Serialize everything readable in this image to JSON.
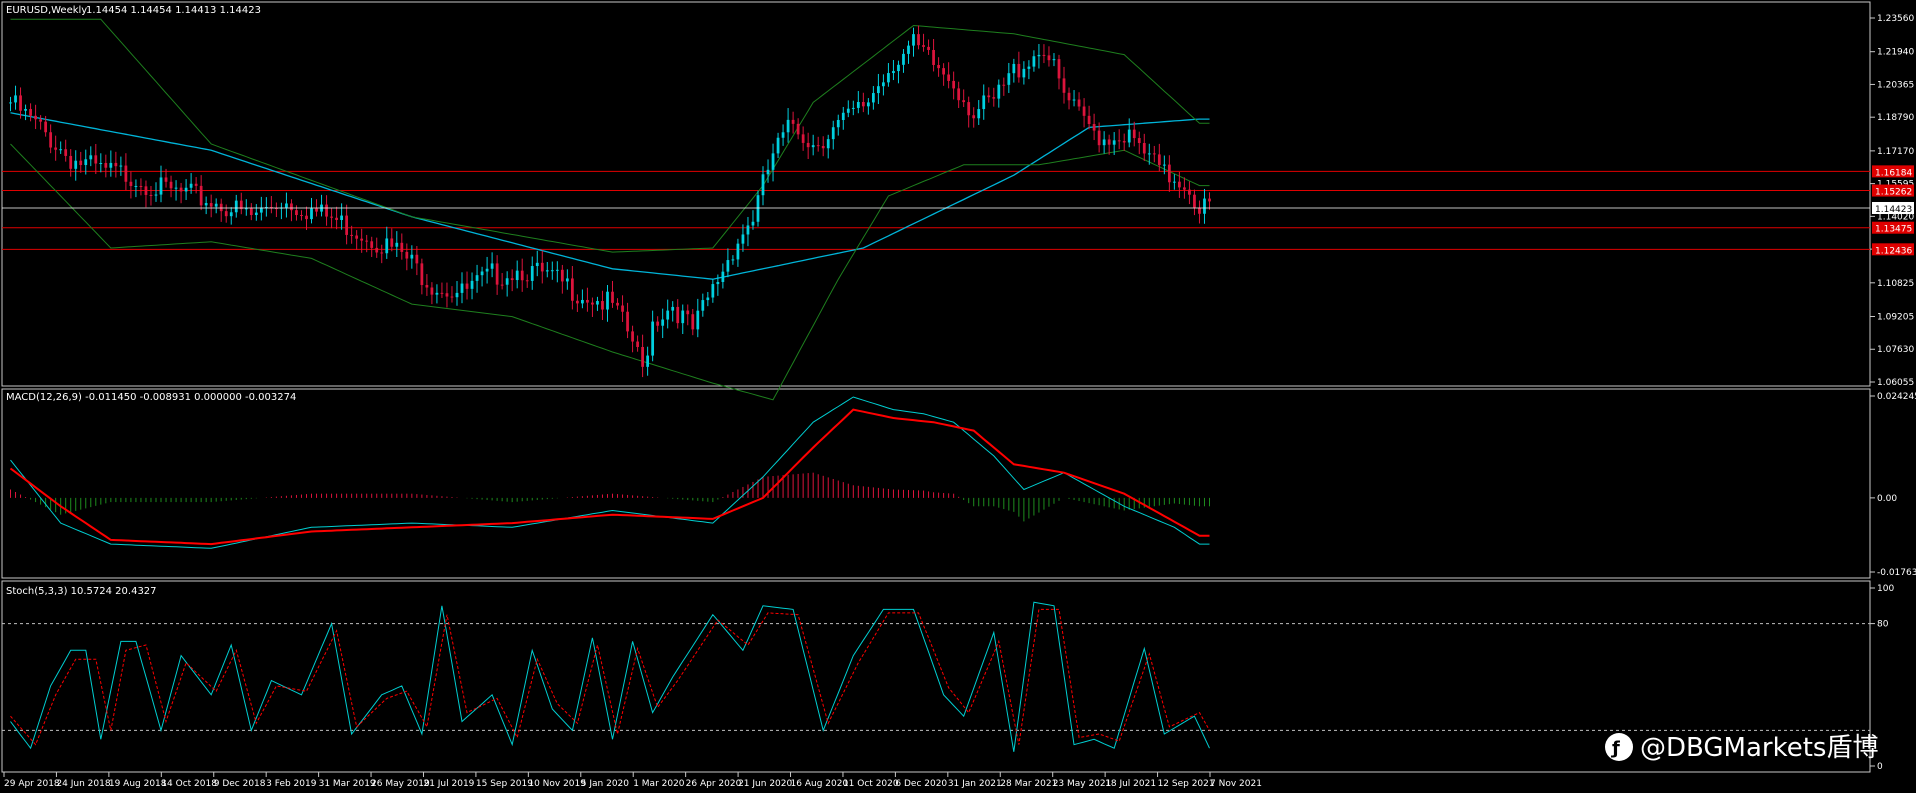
{
  "chart_data": [
    {
      "type": "candlestick",
      "panel": "price",
      "title": "EURUSD,Weekly",
      "ohlc_readout": "1.14454 1.14454 1.14413 1.14423",
      "ylim": [
        1.06055,
        1.2356
      ],
      "y_ticks": [
        "1.23560",
        "1.21940",
        "1.20365",
        "1.18790",
        "1.17170",
        "1.15595",
        "1.14020",
        "1.12445",
        "1.10825",
        "1.09205",
        "1.07630",
        "1.06055"
      ],
      "current_price_label": "1.14423",
      "level_labels": [
        "1.16184",
        "1.15262",
        "1.13475",
        "1.12436"
      ],
      "x_ticks": [
        "29 Apr 2018",
        "24 Jun 2018",
        "19 Aug 2018",
        "14 Oct 2018",
        "9 Dec 2018",
        "3 Feb 2019",
        "31 Mar 2019",
        "26 May 2019",
        "21 Jul 2019",
        "15 Sep 2019",
        "10 Nov 2019",
        "5 Jan 2020",
        "1 Mar 2020",
        "26 Apr 2020",
        "21 Jun 2020",
        "16 Aug 2020",
        "11 Oct 2020",
        "6 Dec 2020",
        "31 Jan 2021",
        "28 Mar 2021",
        "23 May 2021",
        "18 Jul 2021",
        "12 Sep 2021",
        "7 Nov 2021"
      ],
      "close_path": [
        [
          0,
          1.195
        ],
        [
          6,
          1.182
        ],
        [
          12,
          1.168
        ],
        [
          18,
          1.162
        ],
        [
          24,
          1.16
        ],
        [
          30,
          1.153
        ],
        [
          36,
          1.15
        ],
        [
          42,
          1.146
        ],
        [
          48,
          1.14
        ],
        [
          54,
          1.148
        ],
        [
          60,
          1.143
        ],
        [
          66,
          1.137
        ],
        [
          72,
          1.13
        ],
        [
          78,
          1.122
        ],
        [
          84,
          1.108
        ],
        [
          90,
          1.103
        ],
        [
          96,
          1.112
        ],
        [
          102,
          1.115
        ],
        [
          108,
          1.11
        ],
        [
          114,
          1.103
        ],
        [
          120,
          1.097
        ],
        [
          124,
          1.08
        ],
        [
          126,
          1.066
        ],
        [
          128,
          1.09
        ],
        [
          132,
          1.098
        ],
        [
          136,
          1.085
        ],
        [
          140,
          1.105
        ],
        [
          144,
          1.125
        ],
        [
          148,
          1.14
        ],
        [
          152,
          1.17
        ],
        [
          156,
          1.185
        ],
        [
          160,
          1.175
        ],
        [
          164,
          1.182
        ],
        [
          170,
          1.193
        ],
        [
          176,
          1.215
        ],
        [
          180,
          1.222
        ],
        [
          184,
          1.213
        ],
        [
          188,
          1.205
        ],
        [
          192,
          1.19
        ],
        [
          196,
          1.195
        ],
        [
          200,
          1.21
        ],
        [
          206,
          1.222
        ],
        [
          210,
          1.198
        ],
        [
          214,
          1.185
        ],
        [
          218,
          1.178
        ],
        [
          222,
          1.18
        ],
        [
          226,
          1.17
        ],
        [
          230,
          1.16
        ],
        [
          234,
          1.157
        ],
        [
          237,
          1.145
        ]
      ],
      "indicators": [
        {
          "name": "ma_cyan",
          "path": [
            [
              0,
              1.19
            ],
            [
              40,
              1.172
            ],
            [
              80,
              1.14
            ],
            [
              120,
              1.115
            ],
            [
              140,
              1.11
            ],
            [
              170,
              1.125
            ],
            [
              200,
              1.16
            ],
            [
              215,
              1.183
            ],
            [
              237,
              1.187
            ]
          ]
        },
        {
          "name": "bb_upper",
          "path": [
            [
              0,
              1.235
            ],
            [
              18,
              1.235
            ],
            [
              40,
              1.175
            ],
            [
              80,
              1.14
            ],
            [
              120,
              1.123
            ],
            [
              140,
              1.125
            ],
            [
              150,
              1.155
            ],
            [
              160,
              1.195
            ],
            [
              180,
              1.232
            ],
            [
              200,
              1.228
            ],
            [
              222,
              1.218
            ],
            [
              237,
              1.185
            ]
          ]
        },
        {
          "name": "bb_lower",
          "path": [
            [
              0,
              1.175
            ],
            [
              20,
              1.125
            ],
            [
              40,
              1.128
            ],
            [
              60,
              1.12
            ],
            [
              80,
              1.098
            ],
            [
              100,
              1.092
            ],
            [
              120,
              1.075
            ],
            [
              140,
              1.06
            ],
            [
              152,
              1.052
            ],
            [
              165,
              1.11
            ],
            [
              175,
              1.15
            ],
            [
              190,
              1.165
            ],
            [
              205,
              1.165
            ],
            [
              222,
              1.172
            ],
            [
              237,
              1.155
            ]
          ]
        }
      ],
      "horizontal_levels": [
        1.16184,
        1.15262,
        1.13475,
        1.12436
      ],
      "colors": {
        "up": "#00D0E0",
        "down": "#DC143C",
        "ma": "#00B4D8",
        "bands": "#1E7F1E",
        "levels": "#E00000",
        "current": "#FFFFFF"
      }
    },
    {
      "type": "macd",
      "panel": "macd",
      "title": "MACD(12,26,9) -0.011450 -0.008931 0.000000 -0.003274",
      "ylim": [
        -0.017639,
        0.024245
      ],
      "y_ticks": [
        "0.024245",
        "0.00",
        "-0.017639"
      ],
      "main": [
        [
          0,
          0.009
        ],
        [
          10,
          -0.006
        ],
        [
          20,
          -0.011
        ],
        [
          40,
          -0.012
        ],
        [
          60,
          -0.007
        ],
        [
          80,
          -0.006
        ],
        [
          100,
          -0.007
        ],
        [
          120,
          -0.003
        ],
        [
          140,
          -0.006
        ],
        [
          150,
          0.005
        ],
        [
          160,
          0.018
        ],
        [
          168,
          0.024
        ],
        [
          176,
          0.021
        ],
        [
          182,
          0.02
        ],
        [
          188,
          0.018
        ],
        [
          196,
          0.01
        ],
        [
          202,
          0.002
        ],
        [
          210,
          0.006
        ],
        [
          222,
          -0.002
        ],
        [
          232,
          -0.007
        ],
        [
          237,
          -0.011
        ]
      ],
      "signal": [
        [
          0,
          0.007
        ],
        [
          10,
          -0.002
        ],
        [
          20,
          -0.01
        ],
        [
          40,
          -0.011
        ],
        [
          60,
          -0.008
        ],
        [
          80,
          -0.007
        ],
        [
          100,
          -0.006
        ],
        [
          120,
          -0.004
        ],
        [
          140,
          -0.005
        ],
        [
          150,
          0.0
        ],
        [
          160,
          0.012
        ],
        [
          168,
          0.021
        ],
        [
          176,
          0.019
        ],
        [
          184,
          0.018
        ],
        [
          192,
          0.016
        ],
        [
          200,
          0.008
        ],
        [
          210,
          0.006
        ],
        [
          222,
          0.001
        ],
        [
          237,
          -0.009
        ]
      ],
      "colors": {
        "main": "#00CED1",
        "signal": "#FF0000",
        "hist_pos": "#DC143C",
        "hist_neg": "#1E8C1E"
      }
    },
    {
      "type": "stochastic",
      "panel": "stoch",
      "title": "Stoch(5,3,3) 10.5724 20.4327",
      "ylim": [
        0,
        100
      ],
      "y_ticks": [
        "100",
        "80",
        "0"
      ],
      "levels": [
        80,
        20
      ],
      "k": [
        [
          0,
          25
        ],
        [
          4,
          10
        ],
        [
          8,
          45
        ],
        [
          12,
          65
        ],
        [
          15,
          65
        ],
        [
          18,
          15
        ],
        [
          22,
          70
        ],
        [
          25,
          70
        ],
        [
          30,
          20
        ],
        [
          34,
          62
        ],
        [
          40,
          40
        ],
        [
          44,
          68
        ],
        [
          48,
          20
        ],
        [
          52,
          48
        ],
        [
          58,
          40
        ],
        [
          64,
          80
        ],
        [
          68,
          18
        ],
        [
          74,
          40
        ],
        [
          78,
          45
        ],
        [
          82,
          18
        ],
        [
          86,
          90
        ],
        [
          90,
          25
        ],
        [
          96,
          40
        ],
        [
          100,
          12
        ],
        [
          104,
          65
        ],
        [
          108,
          32
        ],
        [
          112,
          20
        ],
        [
          116,
          72
        ],
        [
          120,
          15
        ],
        [
          124,
          70
        ],
        [
          128,
          30
        ],
        [
          132,
          50
        ],
        [
          140,
          85
        ],
        [
          146,
          65
        ],
        [
          150,
          90
        ],
        [
          156,
          88
        ],
        [
          162,
          20
        ],
        [
          168,
          62
        ],
        [
          174,
          88
        ],
        [
          180,
          88
        ],
        [
          186,
          40
        ],
        [
          190,
          28
        ],
        [
          196,
          75
        ],
        [
          200,
          8
        ],
        [
          204,
          92
        ],
        [
          208,
          90
        ],
        [
          212,
          12
        ],
        [
          216,
          15
        ],
        [
          220,
          10
        ],
        [
          226,
          66
        ],
        [
          230,
          18
        ],
        [
          236,
          28
        ],
        [
          239,
          10
        ]
      ],
      "d": [
        [
          0,
          28
        ],
        [
          5,
          12
        ],
        [
          9,
          40
        ],
        [
          13,
          60
        ],
        [
          17,
          60
        ],
        [
          20,
          20
        ],
        [
          23,
          65
        ],
        [
          27,
          68
        ],
        [
          31,
          25
        ],
        [
          35,
          58
        ],
        [
          41,
          42
        ],
        [
          45,
          65
        ],
        [
          49,
          24
        ],
        [
          53,
          45
        ],
        [
          59,
          42
        ],
        [
          65,
          76
        ],
        [
          69,
          22
        ],
        [
          75,
          38
        ],
        [
          79,
          42
        ],
        [
          83,
          22
        ],
        [
          87,
          85
        ],
        [
          91,
          30
        ],
        [
          97,
          38
        ],
        [
          101,
          16
        ],
        [
          105,
          60
        ],
        [
          109,
          35
        ],
        [
          113,
          24
        ],
        [
          117,
          68
        ],
        [
          121,
          18
        ],
        [
          125,
          66
        ],
        [
          129,
          33
        ],
        [
          133,
          48
        ],
        [
          141,
          82
        ],
        [
          147,
          68
        ],
        [
          151,
          86
        ],
        [
          157,
          85
        ],
        [
          163,
          24
        ],
        [
          169,
          58
        ],
        [
          175,
          86
        ],
        [
          181,
          86
        ],
        [
          187,
          44
        ],
        [
          191,
          30
        ],
        [
          197,
          70
        ],
        [
          201,
          12
        ],
        [
          205,
          88
        ],
        [
          209,
          88
        ],
        [
          213,
          16
        ],
        [
          217,
          18
        ],
        [
          221,
          14
        ],
        [
          227,
          63
        ],
        [
          231,
          22
        ],
        [
          237,
          30
        ],
        [
          239,
          20
        ]
      ],
      "colors": {
        "k": "#00CED1",
        "d": "#FF0000",
        "levels": "#C0C0C0"
      }
    }
  ],
  "watermark_text": "@DBGMarkets盾博"
}
